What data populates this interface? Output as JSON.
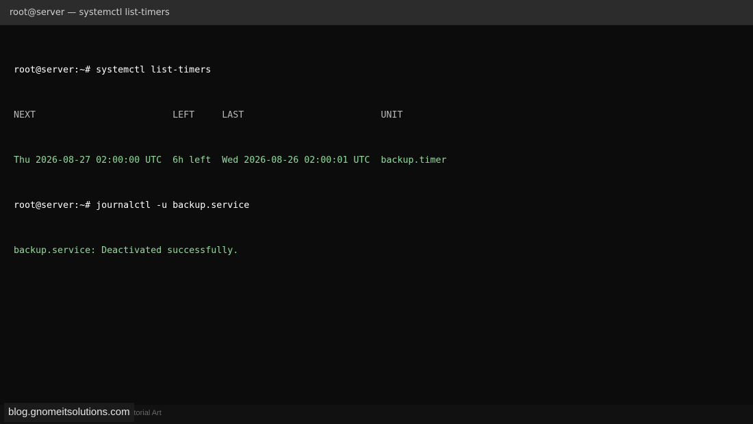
{
  "window": {
    "title": "root@server — systemctl list-timers"
  },
  "terminal": {
    "line1": {
      "prompt": "root@server:~# ",
      "command": "systemctl list-timers"
    },
    "line2": {
      "header": "NEXT                         LEFT     LAST                         UNIT"
    },
    "line3": {
      "row": "Thu 2026-08-27 02:00:00 UTC  6h left  Wed 2026-08-26 02:00:01 UTC  backup.timer"
    },
    "line4": {
      "prompt": "root@server:~# ",
      "command": "journalctl -u backup.service"
    },
    "line5": {
      "output": "backup.service: Deactivated successfully."
    }
  },
  "footer": {
    "caption": "Tutorial Art",
    "watermark": "blog.gnomeitsolutions.com"
  },
  "colors": {
    "background": "#0c0c0c",
    "titlebar": "#2c2c2c",
    "output_green": "#8fdc9a"
  }
}
